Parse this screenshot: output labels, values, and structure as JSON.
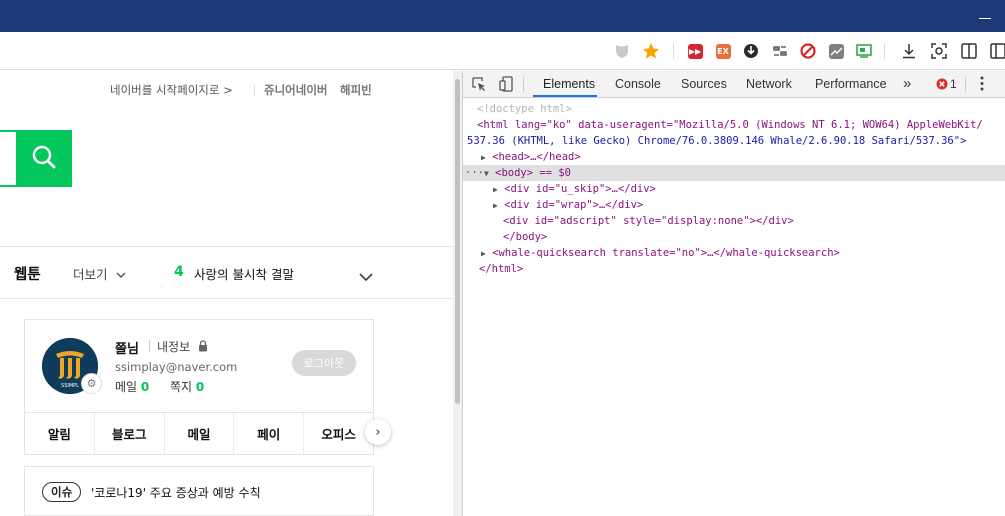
{
  "toolbar": {
    "icons": [
      "shield-icon",
      "bookmark-star-icon",
      "ext-forward-icon",
      "ext-ex-icon",
      "ext-download-icon",
      "ext-mirror-icon",
      "ext-block-icon",
      "ext-chart-icon",
      "ext-screen-icon",
      "download-icon",
      "screenshot-icon",
      "sidebar-icon",
      "split-view-icon"
    ],
    "accent_star": "#f5a400"
  },
  "naver": {
    "top_links": {
      "set_homepage": "네이버를 시작페이지로 >",
      "junior": "쥬니어네이버",
      "happybean": "해피빈"
    },
    "webtoon": {
      "title": "웹툰",
      "more": "더보기",
      "rank": "4",
      "rank_title": "사랑의 불시착 결말"
    },
    "profile": {
      "name": "쯜님",
      "my_info": "내정보",
      "email": "ssimplay@naver.com",
      "mail_label": "메일",
      "mail_count": "0",
      "note_label": "쪽지",
      "note_count": "0",
      "logout": "로그아웃",
      "avatar_text": "SSIMPL"
    },
    "services": [
      "알림",
      "블로그",
      "메일",
      "페이",
      "오피스"
    ],
    "issue": {
      "badge": "이슈",
      "text": "'코로나19' 주요 증상과 예방 수칙"
    },
    "brand_green": "#03c75a"
  },
  "devtools": {
    "tabs": [
      "Elements",
      "Console",
      "Sources",
      "Network",
      "Performance"
    ],
    "more_tabs": "»",
    "error_count": "1",
    "dom": {
      "doctype": "<!doctype html>",
      "html_open_1": "<html lang=\"ko\" data-useragent=\"Mozilla/5.0 (Windows NT 6.1; WOW64) AppleWebKit/",
      "html_open_2": "537.36 (KHTML, like Gecko) Chrome/76.0.3809.146 Whale/2.6.90.18 Safari/537.36\">",
      "head": "<head>…</head>",
      "body_selected": "<body> == $0",
      "div_u_skip": "<div id=\"u_skip\">…</div>",
      "div_wrap": "<div id=\"wrap\">…</div>",
      "div_adscript": "<div id=\"adscript\" style=\"display:none\"></div>",
      "body_close": "</body>",
      "whale_quicksearch": "<whale-quicksearch translate=\"no\">…</whale-quicksearch>",
      "html_close": "</html>"
    }
  }
}
